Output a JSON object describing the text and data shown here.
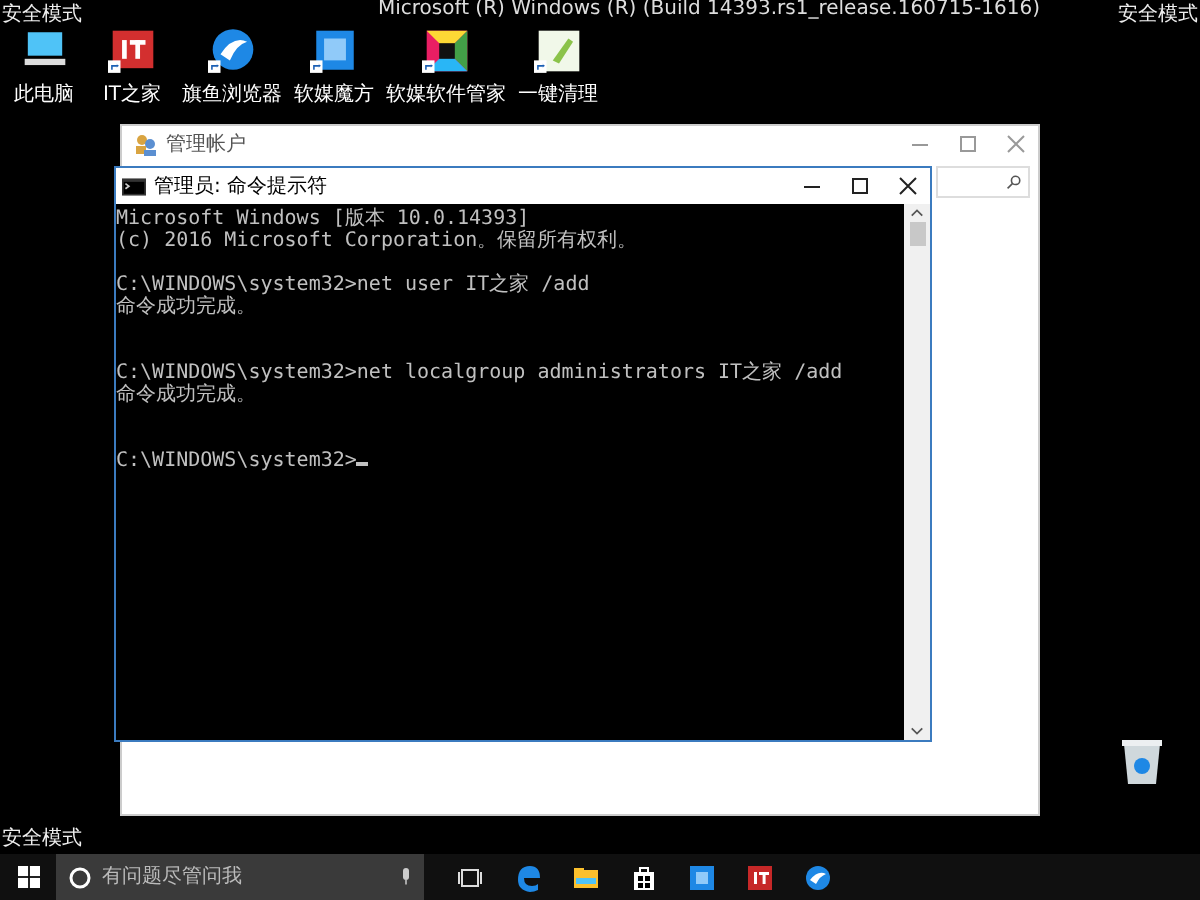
{
  "desktop": {
    "safe_mode_labels": [
      "安全模式",
      "安全模式",
      "安全模式"
    ],
    "build_text": "Microsoft (R) Windows (R) (Build 14393.rs1_release.160715-1616)",
    "icons": [
      {
        "label": "此电脑",
        "kind": "pc"
      },
      {
        "label": "IT之家",
        "kind": "it"
      },
      {
        "label": "旗鱼浏览器",
        "kind": "browser"
      },
      {
        "label": "软媒魔方",
        "kind": "cube"
      },
      {
        "label": "软媒软件管家",
        "kind": "manager"
      },
      {
        "label": "一键清理",
        "kind": "clean"
      }
    ]
  },
  "back_window": {
    "title": "管理帐户"
  },
  "cmd_window": {
    "title": "管理员: 命令提示符",
    "cursor": true,
    "blocks": [
      [
        "Microsoft Windows [版本 10.0.14393]",
        "(c) 2016 Microsoft Corporation。保留所有权利。"
      ],
      [
        "C:\\WINDOWS\\system32>net user IT之家 /add",
        "命令成功完成。"
      ],
      [
        "C:\\WINDOWS\\system32>net localgroup administrators IT之家 /add",
        "命令成功完成。"
      ],
      [
        "C:\\WINDOWS\\system32>"
      ]
    ]
  },
  "taskbar": {
    "search": {
      "placeholder": "有问题尽管问我"
    },
    "apps": [
      {
        "kind": "taskview"
      },
      {
        "kind": "edge"
      },
      {
        "kind": "folder"
      },
      {
        "kind": "store"
      },
      {
        "kind": "cube"
      },
      {
        "kind": "it"
      },
      {
        "kind": "browser"
      }
    ]
  }
}
